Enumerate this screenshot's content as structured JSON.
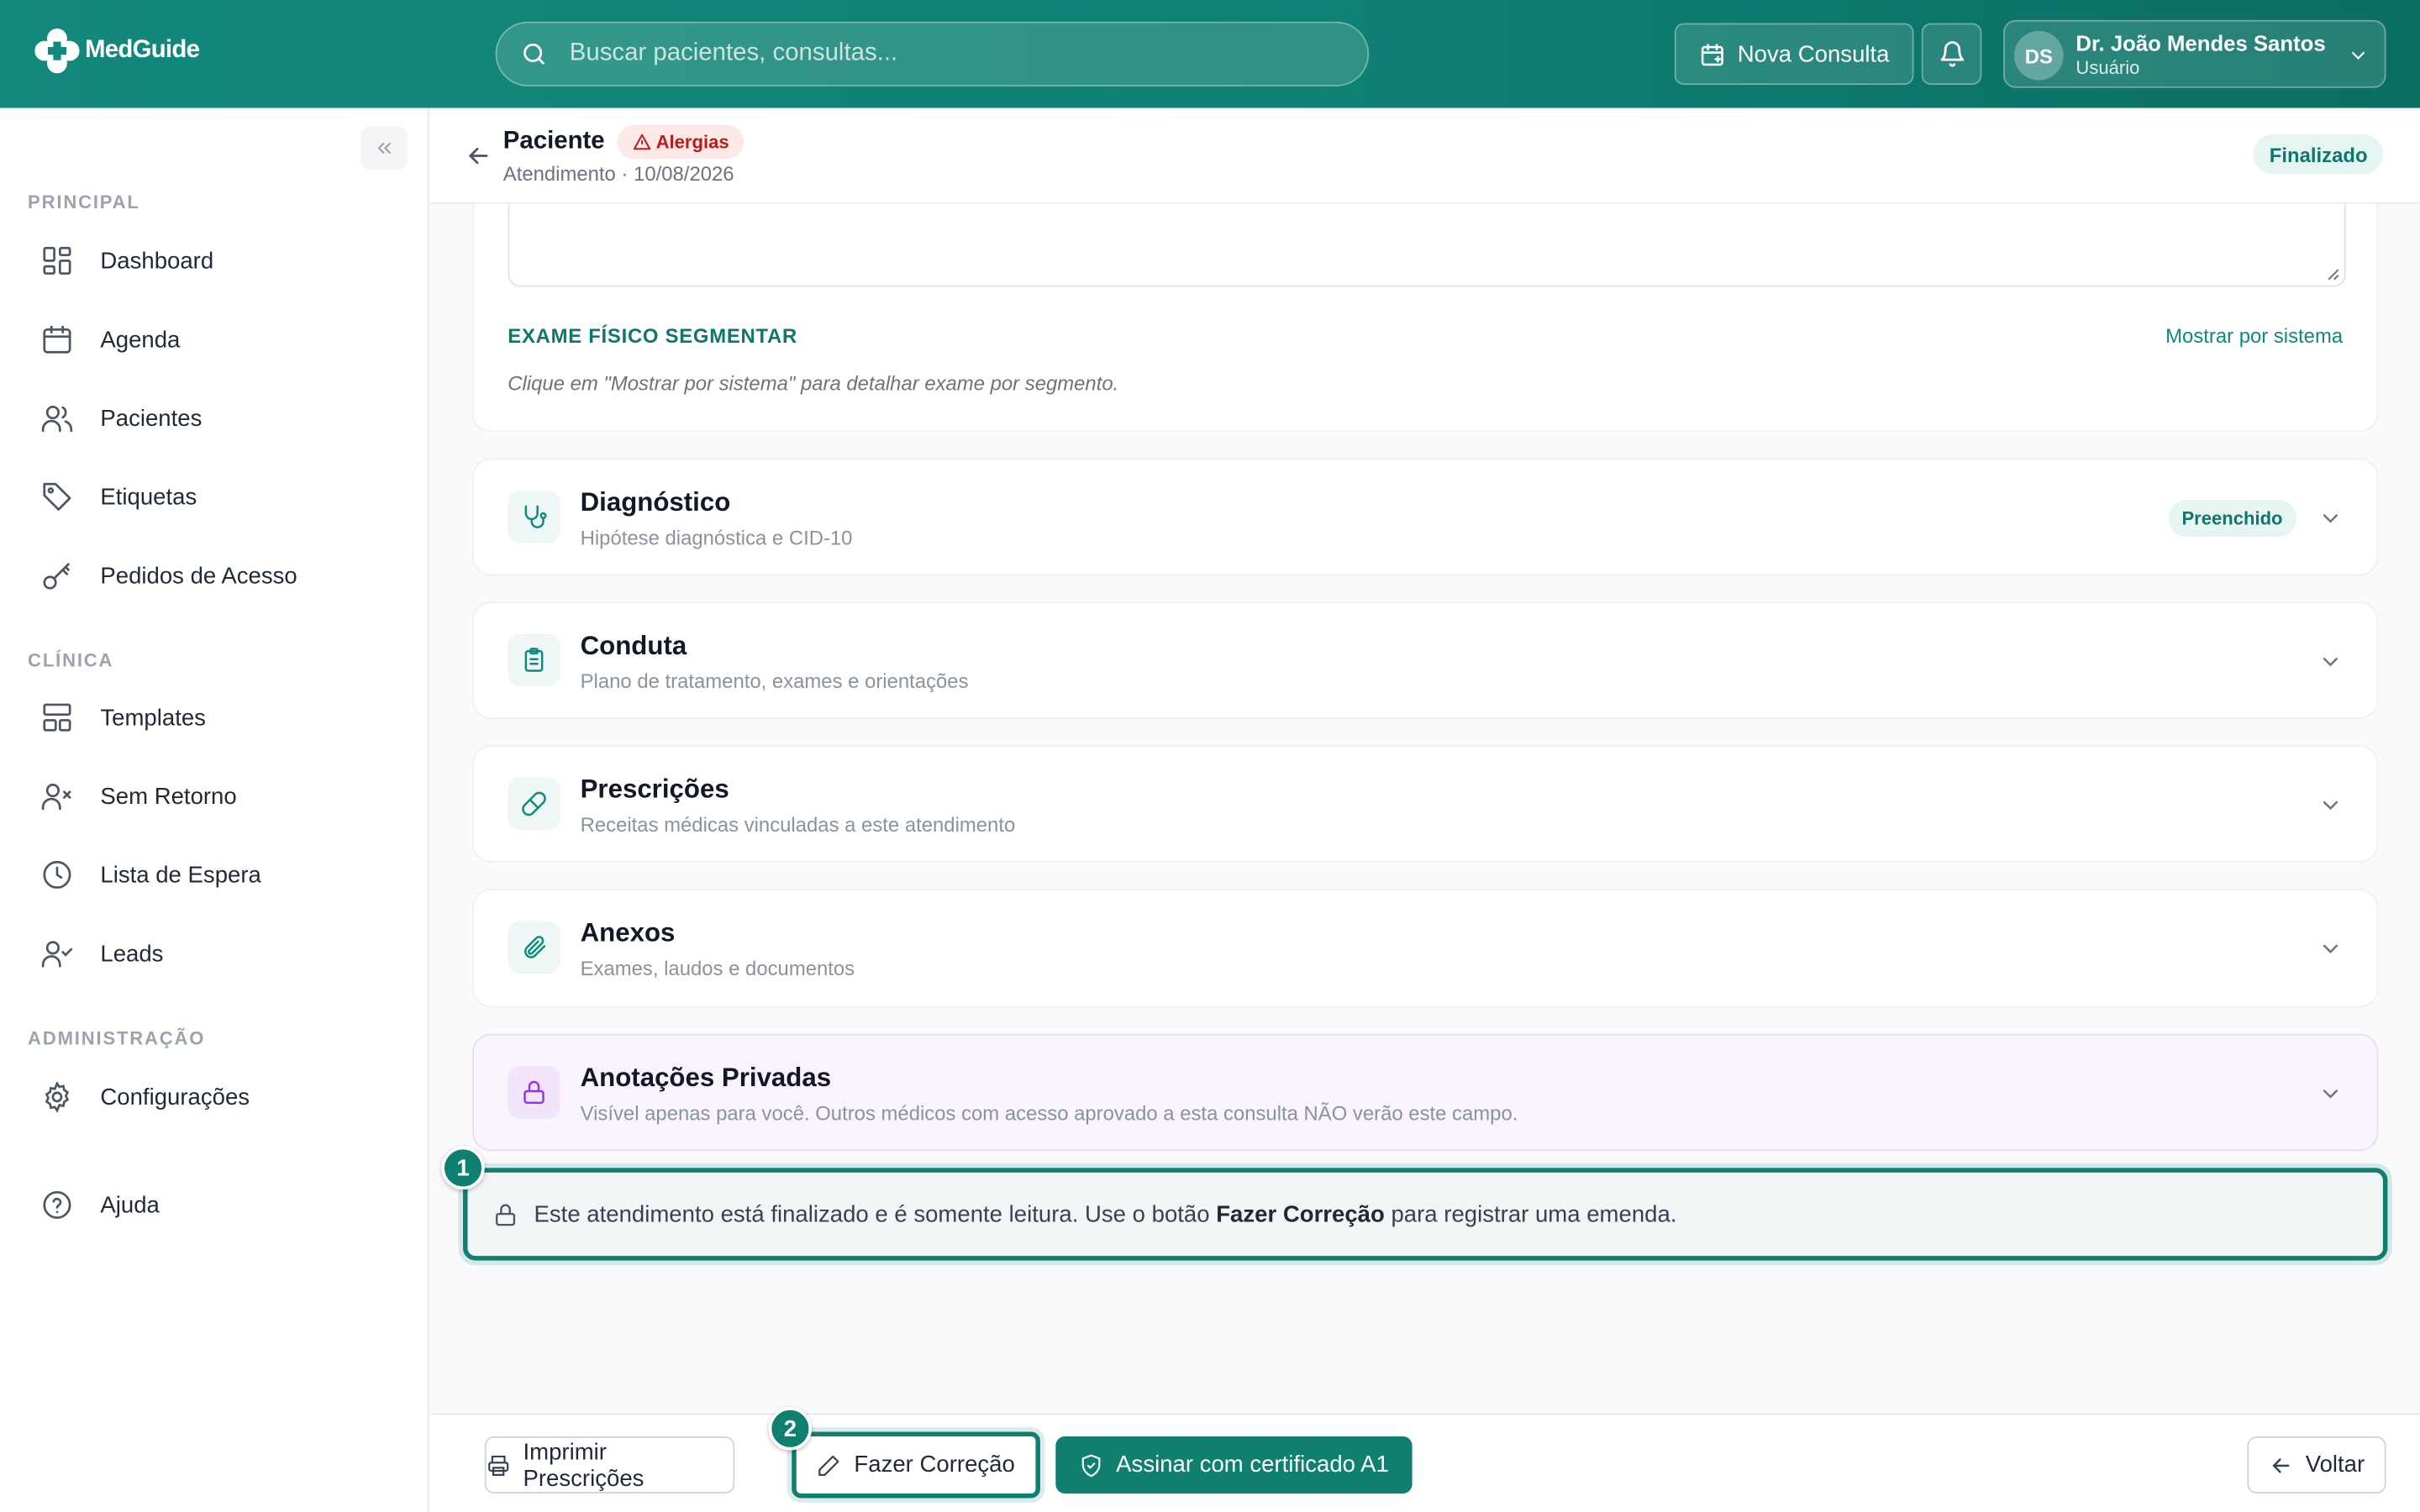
{
  "app": {
    "name": "MedGuide"
  },
  "header": {
    "search_placeholder": "Buscar pacientes, consultas...",
    "new_consult_label": "Nova Consulta",
    "user": {
      "initials": "DS",
      "name": "Dr. João Mendes Santos",
      "role": "Usuário"
    }
  },
  "sidebar": {
    "sections": [
      {
        "title": "PRINCIPAL",
        "items": [
          {
            "label": "Dashboard",
            "icon": "dashboard-icon"
          },
          {
            "label": "Agenda",
            "icon": "calendar-icon"
          },
          {
            "label": "Pacientes",
            "icon": "users-icon"
          },
          {
            "label": "Etiquetas",
            "icon": "tag-icon"
          },
          {
            "label": "Pedidos de Acesso",
            "icon": "key-icon"
          }
        ]
      },
      {
        "title": "CLÍNICA",
        "items": [
          {
            "label": "Templates",
            "icon": "layout-icon"
          },
          {
            "label": "Sem Retorno",
            "icon": "user-x-icon"
          },
          {
            "label": "Lista de Espera",
            "icon": "clock-icon"
          },
          {
            "label": "Leads",
            "icon": "user-check-icon"
          }
        ]
      },
      {
        "title": "ADMINISTRAÇÃO",
        "items": [
          {
            "label": "Configurações",
            "icon": "gear-icon"
          }
        ]
      }
    ],
    "help_label": "Ajuda"
  },
  "patient": {
    "title": "Paciente",
    "allergy_badge": "Alergias",
    "subtitle": "Atendimento · 10/08/2026",
    "status": "Finalizado"
  },
  "exam": {
    "title": "EXAME FÍSICO SEGMENTAR",
    "link": "Mostrar por sistema",
    "hint": "Clique em \"Mostrar por sistema\" para detalhar exame por segmento."
  },
  "sections": [
    {
      "title": "Diagnóstico",
      "subtitle": "Hipótese diagnóstica e CID-10",
      "badge": "Preenchido",
      "icon": "stethoscope-icon"
    },
    {
      "title": "Conduta",
      "subtitle": "Plano de tratamento, exames e orientações",
      "icon": "clipboard-icon"
    },
    {
      "title": "Prescrições",
      "subtitle": "Receitas médicas vinculadas a este atendimento",
      "icon": "pill-icon"
    },
    {
      "title": "Anexos",
      "subtitle": "Exames, laudos e documentos",
      "icon": "paperclip-icon"
    },
    {
      "title": "Anotações Privadas",
      "subtitle": "Visível apenas para você. Outros médicos com acesso aprovado a esta consulta NÃO verão este campo.",
      "icon": "lock-icon"
    }
  ],
  "readonly_banner": {
    "prefix": "Este atendimento está finalizado e é somente leitura. Use o botão ",
    "bold": "Fazer Correção",
    "suffix": " para registrar uma emenda."
  },
  "markers": [
    "1",
    "2"
  ],
  "footer": {
    "print_label": "Imprimir Prescrições",
    "correct_label": "Fazer Correção",
    "sign_label": "Assinar com certificado A1",
    "back_label": "Voltar"
  },
  "colors": {
    "primary": "#0f7f70",
    "header": "#13897b",
    "allergy": "#b91c1c",
    "private_bg": "#faf4fe"
  }
}
